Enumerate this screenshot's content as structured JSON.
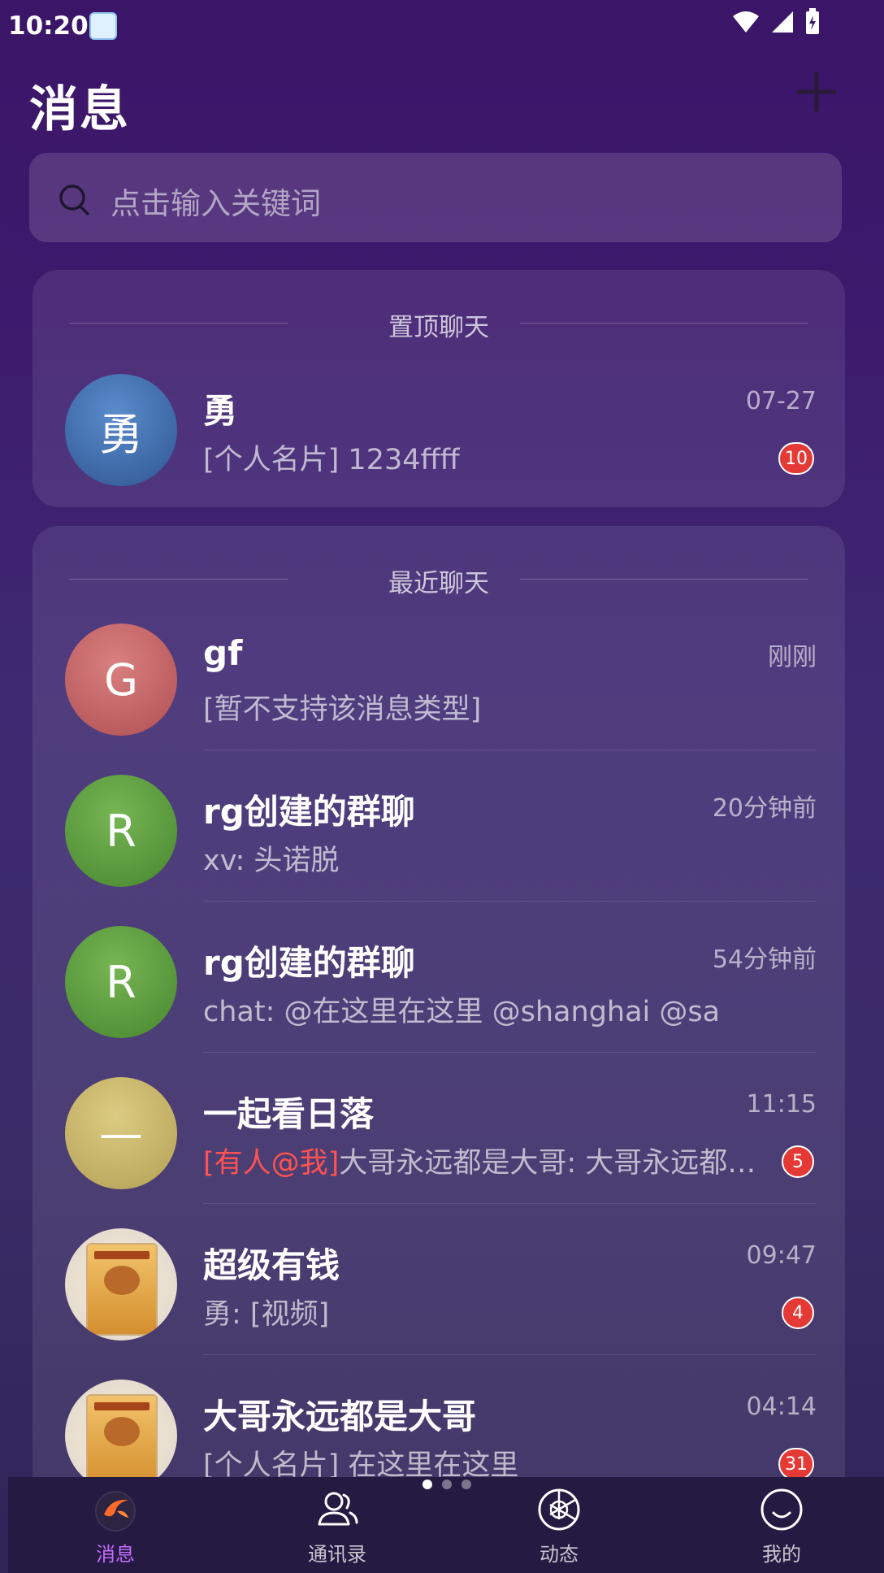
{
  "status_bar": {
    "time": "10:20"
  },
  "header": {
    "title": "消息"
  },
  "search": {
    "placeholder": "点击输入关键词"
  },
  "pinned": {
    "section_label": "置顶聊天",
    "items": [
      {
        "avatar_text": "勇",
        "avatar_color": "#3f6fae",
        "name": "勇",
        "time": "07-27",
        "preview": "[个人名片] 1234ffff",
        "badge": "10"
      }
    ]
  },
  "recent": {
    "section_label": "最近聊天",
    "items": [
      {
        "avatar_text": "G",
        "avatar_color": "#c86262",
        "name": "gf",
        "time": "刚刚",
        "preview": "[暂不支持该消息类型]"
      },
      {
        "avatar_text": "R",
        "avatar_color": "#5a9a3a",
        "name": "rg创建的群聊",
        "time": "20分钟前",
        "preview": "xv: 头诺脱"
      },
      {
        "avatar_text": "R",
        "avatar_color": "#5a9a3a",
        "name": "rg创建的群聊",
        "time": "54分钟前",
        "preview": "chat: @在这里在这里 @shanghai @sa"
      },
      {
        "avatar_text": "—",
        "avatar_color": "#c9b76a",
        "name": "一起看日落",
        "time": "11:15",
        "mention": "[有人@我]",
        "preview": "大哥永远都是大哥: 大哥永远都…",
        "badge": "5"
      },
      {
        "avatar_type": "photo",
        "name": "超级有钱",
        "time": "09:47",
        "preview": "勇: [视频]",
        "badge": "4"
      },
      {
        "avatar_type": "photo",
        "name": "大哥永远都是大哥",
        "time": "04:14",
        "preview": "[个人名片] 在这里在这里",
        "badge": "31"
      }
    ]
  },
  "tabs": [
    {
      "label": "消息",
      "icon": "message-icon",
      "active": true
    },
    {
      "label": "通讯录",
      "icon": "contacts-icon",
      "active": false
    },
    {
      "label": "动态",
      "icon": "moments-icon",
      "active": false
    },
    {
      "label": "我的",
      "icon": "profile-icon",
      "active": false
    }
  ],
  "colors": {
    "accent": "#c36bff",
    "badge": "#e53935",
    "mention": "#ff5252"
  }
}
